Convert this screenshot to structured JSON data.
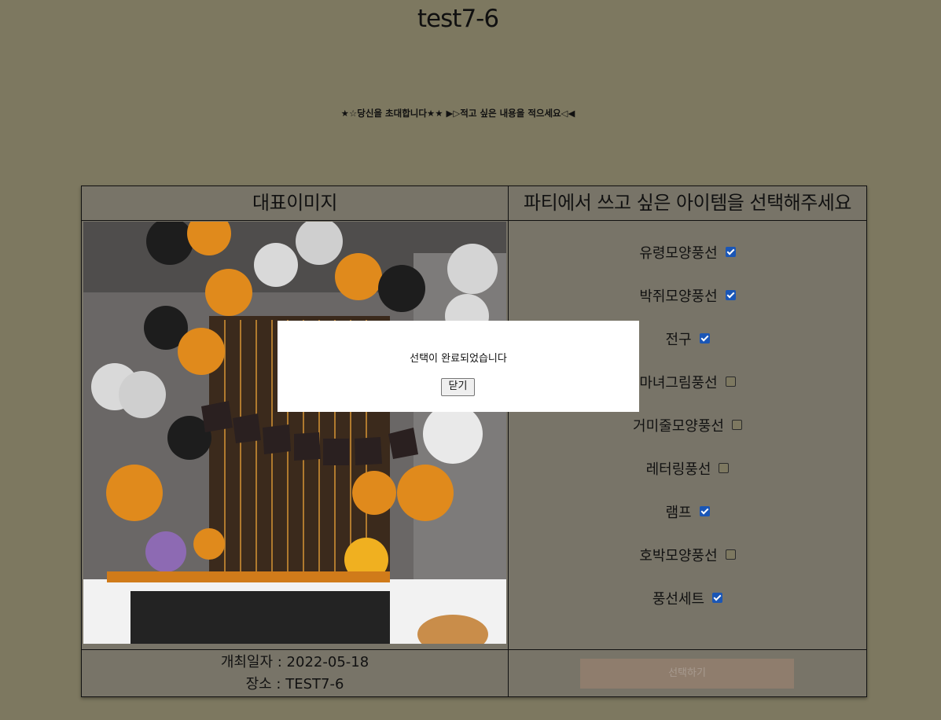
{
  "header": {
    "title": "test7-6",
    "invitation": "★☆당신을 초대합니다★★ ▶▷적고 싶은 내용을 적으세요◁◀"
  },
  "table": {
    "image_header": "대표이미지",
    "items_header": "파티에서 쓰고 싶은 아이템을 선택해주세요",
    "date_line": "개최일자 : 2022-05-18",
    "place_line": "장소 : TEST7-6",
    "items": [
      {
        "label": "유령모양풍선",
        "checked": true
      },
      {
        "label": "박쥐모양풍선",
        "checked": true
      },
      {
        "label": "전구",
        "checked": true
      },
      {
        "label": "마녀그림풍선",
        "checked": false
      },
      {
        "label": "거미줄모양풍선",
        "checked": false
      },
      {
        "label": "레터링풍선",
        "checked": false
      },
      {
        "label": "램프",
        "checked": true
      },
      {
        "label": "호박모양풍선",
        "checked": false
      },
      {
        "label": "풍선세트",
        "checked": true
      }
    ],
    "select_button": "선택하기"
  },
  "modal": {
    "message": "선택이 완료되었습니다",
    "close_button": "닫기"
  },
  "colors": {
    "background": "#7d7860",
    "checkbox_checked": "#1a56b6",
    "select_button": "#8f7d6d"
  }
}
